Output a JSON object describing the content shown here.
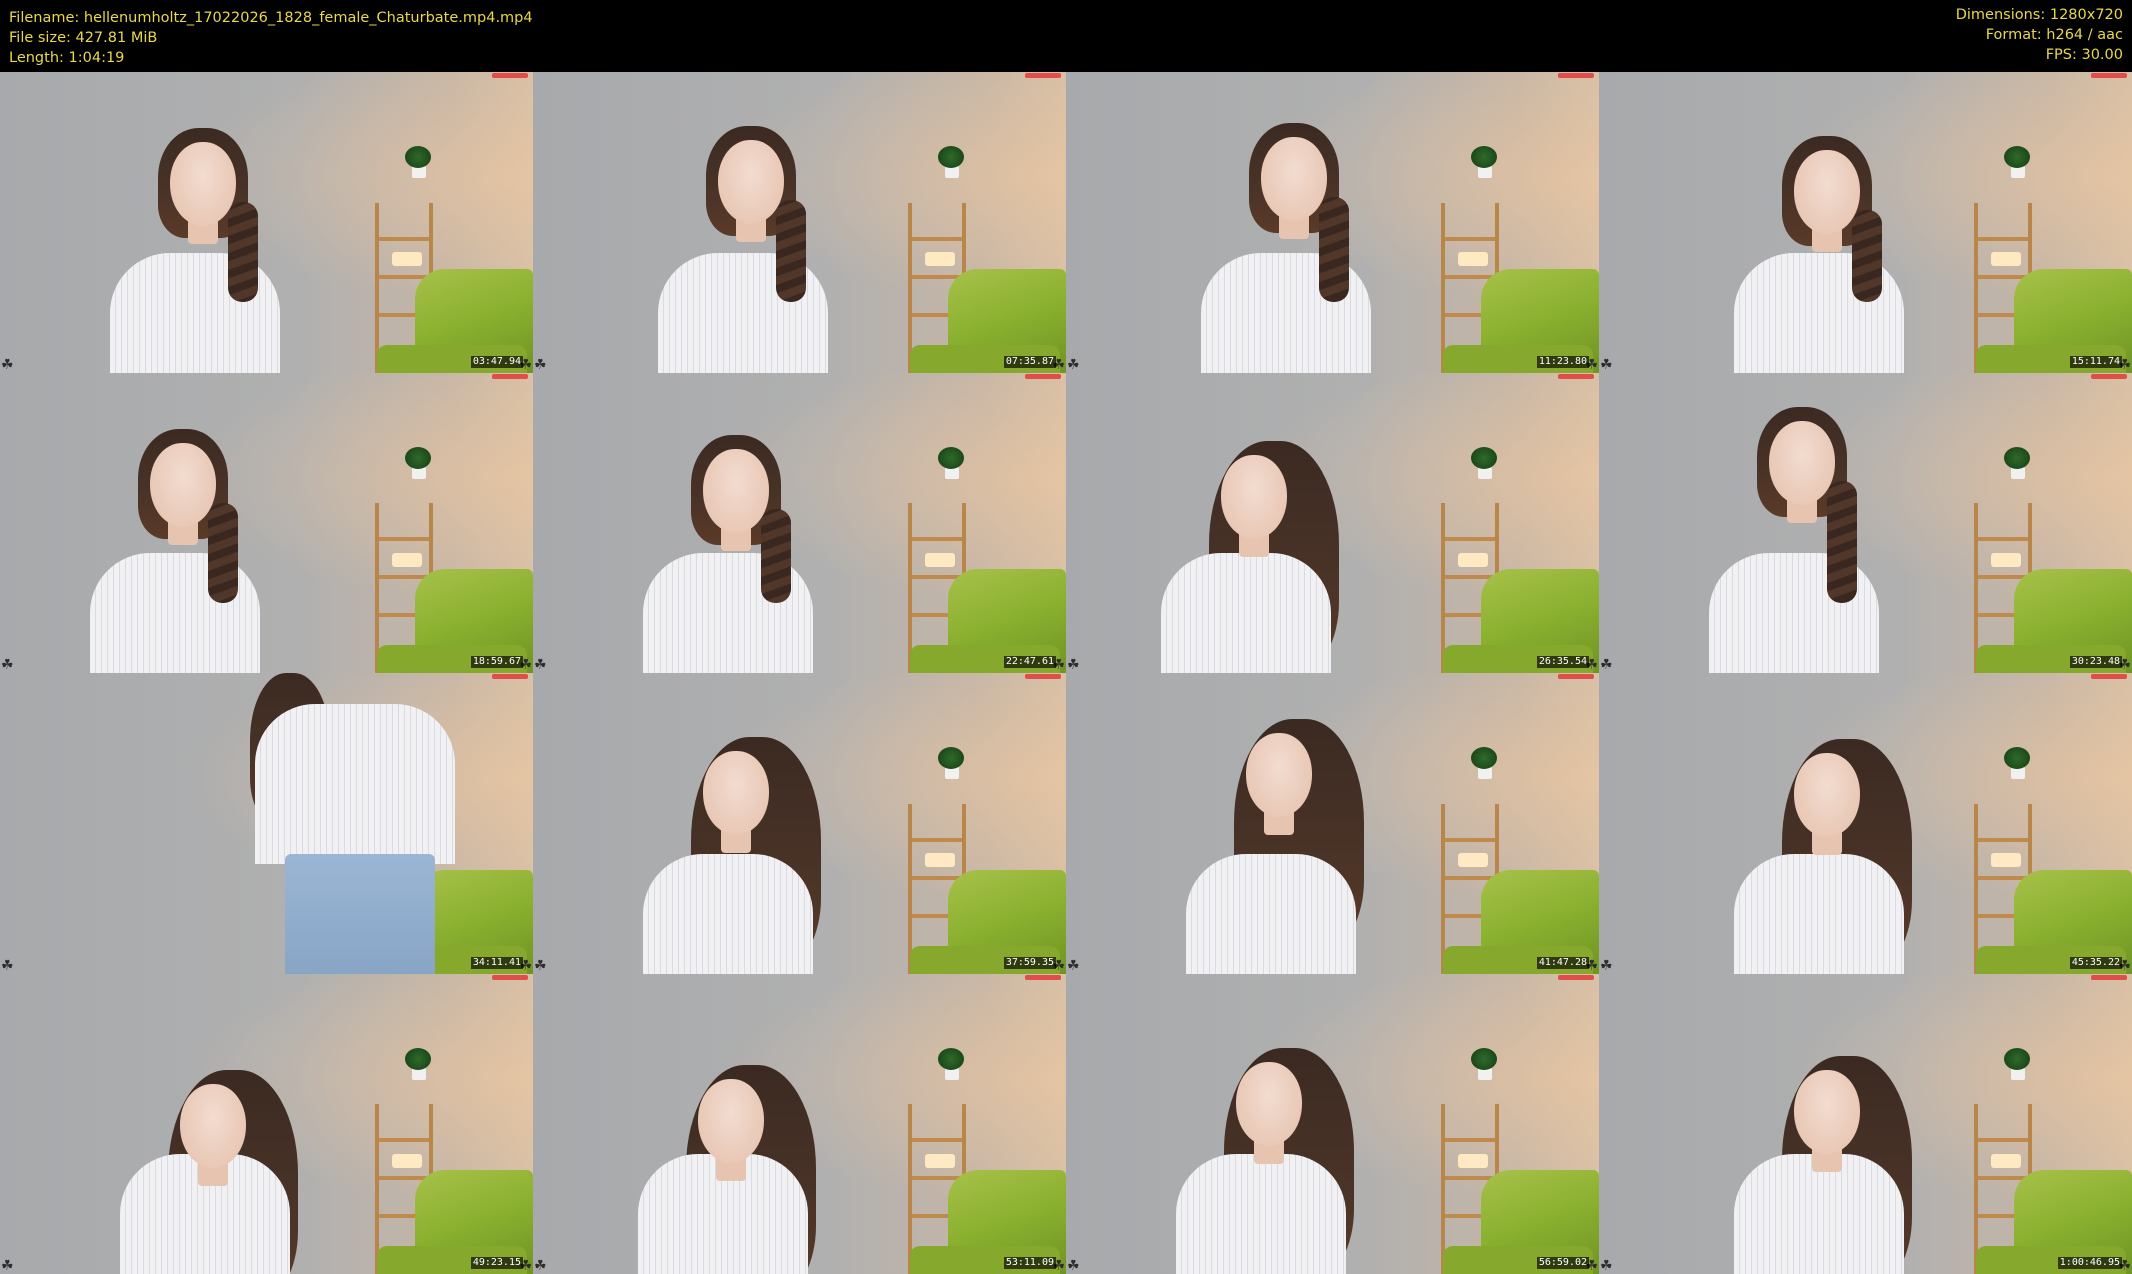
{
  "header": {
    "filename_label": "Filename: hellenumholtz_17022026_1828_female_Chaturbate.mp4.mp4",
    "filesize_label": "File size: 427.81 MiB",
    "length_label": "Length: 1:04:19",
    "dimensions_label": "Dimensions: 1280x720",
    "format_label": "Format: h264 / aac",
    "fps_label": "FPS: 30.00",
    "text_color": "#e8d84a"
  },
  "thumbnails": [
    {
      "timestamp": "03:47.94"
    },
    {
      "timestamp": "07:35.87"
    },
    {
      "timestamp": "11:23.80"
    },
    {
      "timestamp": "15:11.74"
    },
    {
      "timestamp": "18:59.67"
    },
    {
      "timestamp": "22:47.61"
    },
    {
      "timestamp": "26:35.54"
    },
    {
      "timestamp": "30:23.48"
    },
    {
      "timestamp": "34:11.41"
    },
    {
      "timestamp": "37:59.35"
    },
    {
      "timestamp": "41:47.28"
    },
    {
      "timestamp": "45:35.22"
    },
    {
      "timestamp": "49:23.15"
    },
    {
      "timestamp": "53:11.09"
    },
    {
      "timestamp": "56:59.02"
    },
    {
      "timestamp": "1:00:46.95"
    }
  ],
  "icons": {
    "corner_left": "leaf-icon",
    "corner_right": "leaf-icon",
    "rec_mark": "recording-indicator"
  }
}
